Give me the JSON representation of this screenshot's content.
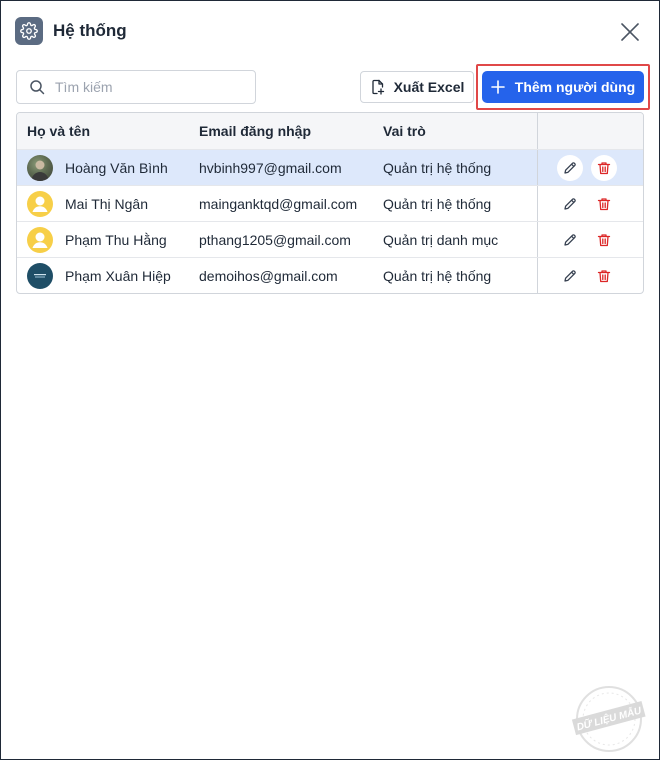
{
  "dialog": {
    "title": "Hệ thống",
    "icon": "gear-icon"
  },
  "toolbar": {
    "search_placeholder": "Tìm kiếm",
    "export_label": "Xuất Excel",
    "add_label": "Thêm người dùng",
    "accent_color": "#2563eb",
    "highlight_color": "#e04848"
  },
  "table": {
    "columns": [
      "Họ và tên",
      "Email đăng nhập",
      "Vai trò",
      ""
    ],
    "rows": [
      {
        "name": "Hoàng Văn Bình",
        "email": "hvbinh997@gmail.com",
        "role": "Quản trị hệ thống",
        "avatar": "photo",
        "selected": true
      },
      {
        "name": "Mai Thị Ngân",
        "email": "mainganktqd@gmail.com",
        "role": "Quản trị hệ thống",
        "avatar": "default",
        "selected": false
      },
      {
        "name": "Phạm Thu Hằng",
        "email": "pthang1205@gmail.com",
        "role": "Quản trị danh mục",
        "avatar": "default",
        "selected": false
      },
      {
        "name": "Phạm Xuân Hiệp",
        "email": "demoihos@gmail.com",
        "role": "Quản trị hệ thống",
        "avatar": "logo",
        "selected": false
      }
    ]
  },
  "watermark": {
    "text": "DỮ LIỆU MẪU"
  }
}
